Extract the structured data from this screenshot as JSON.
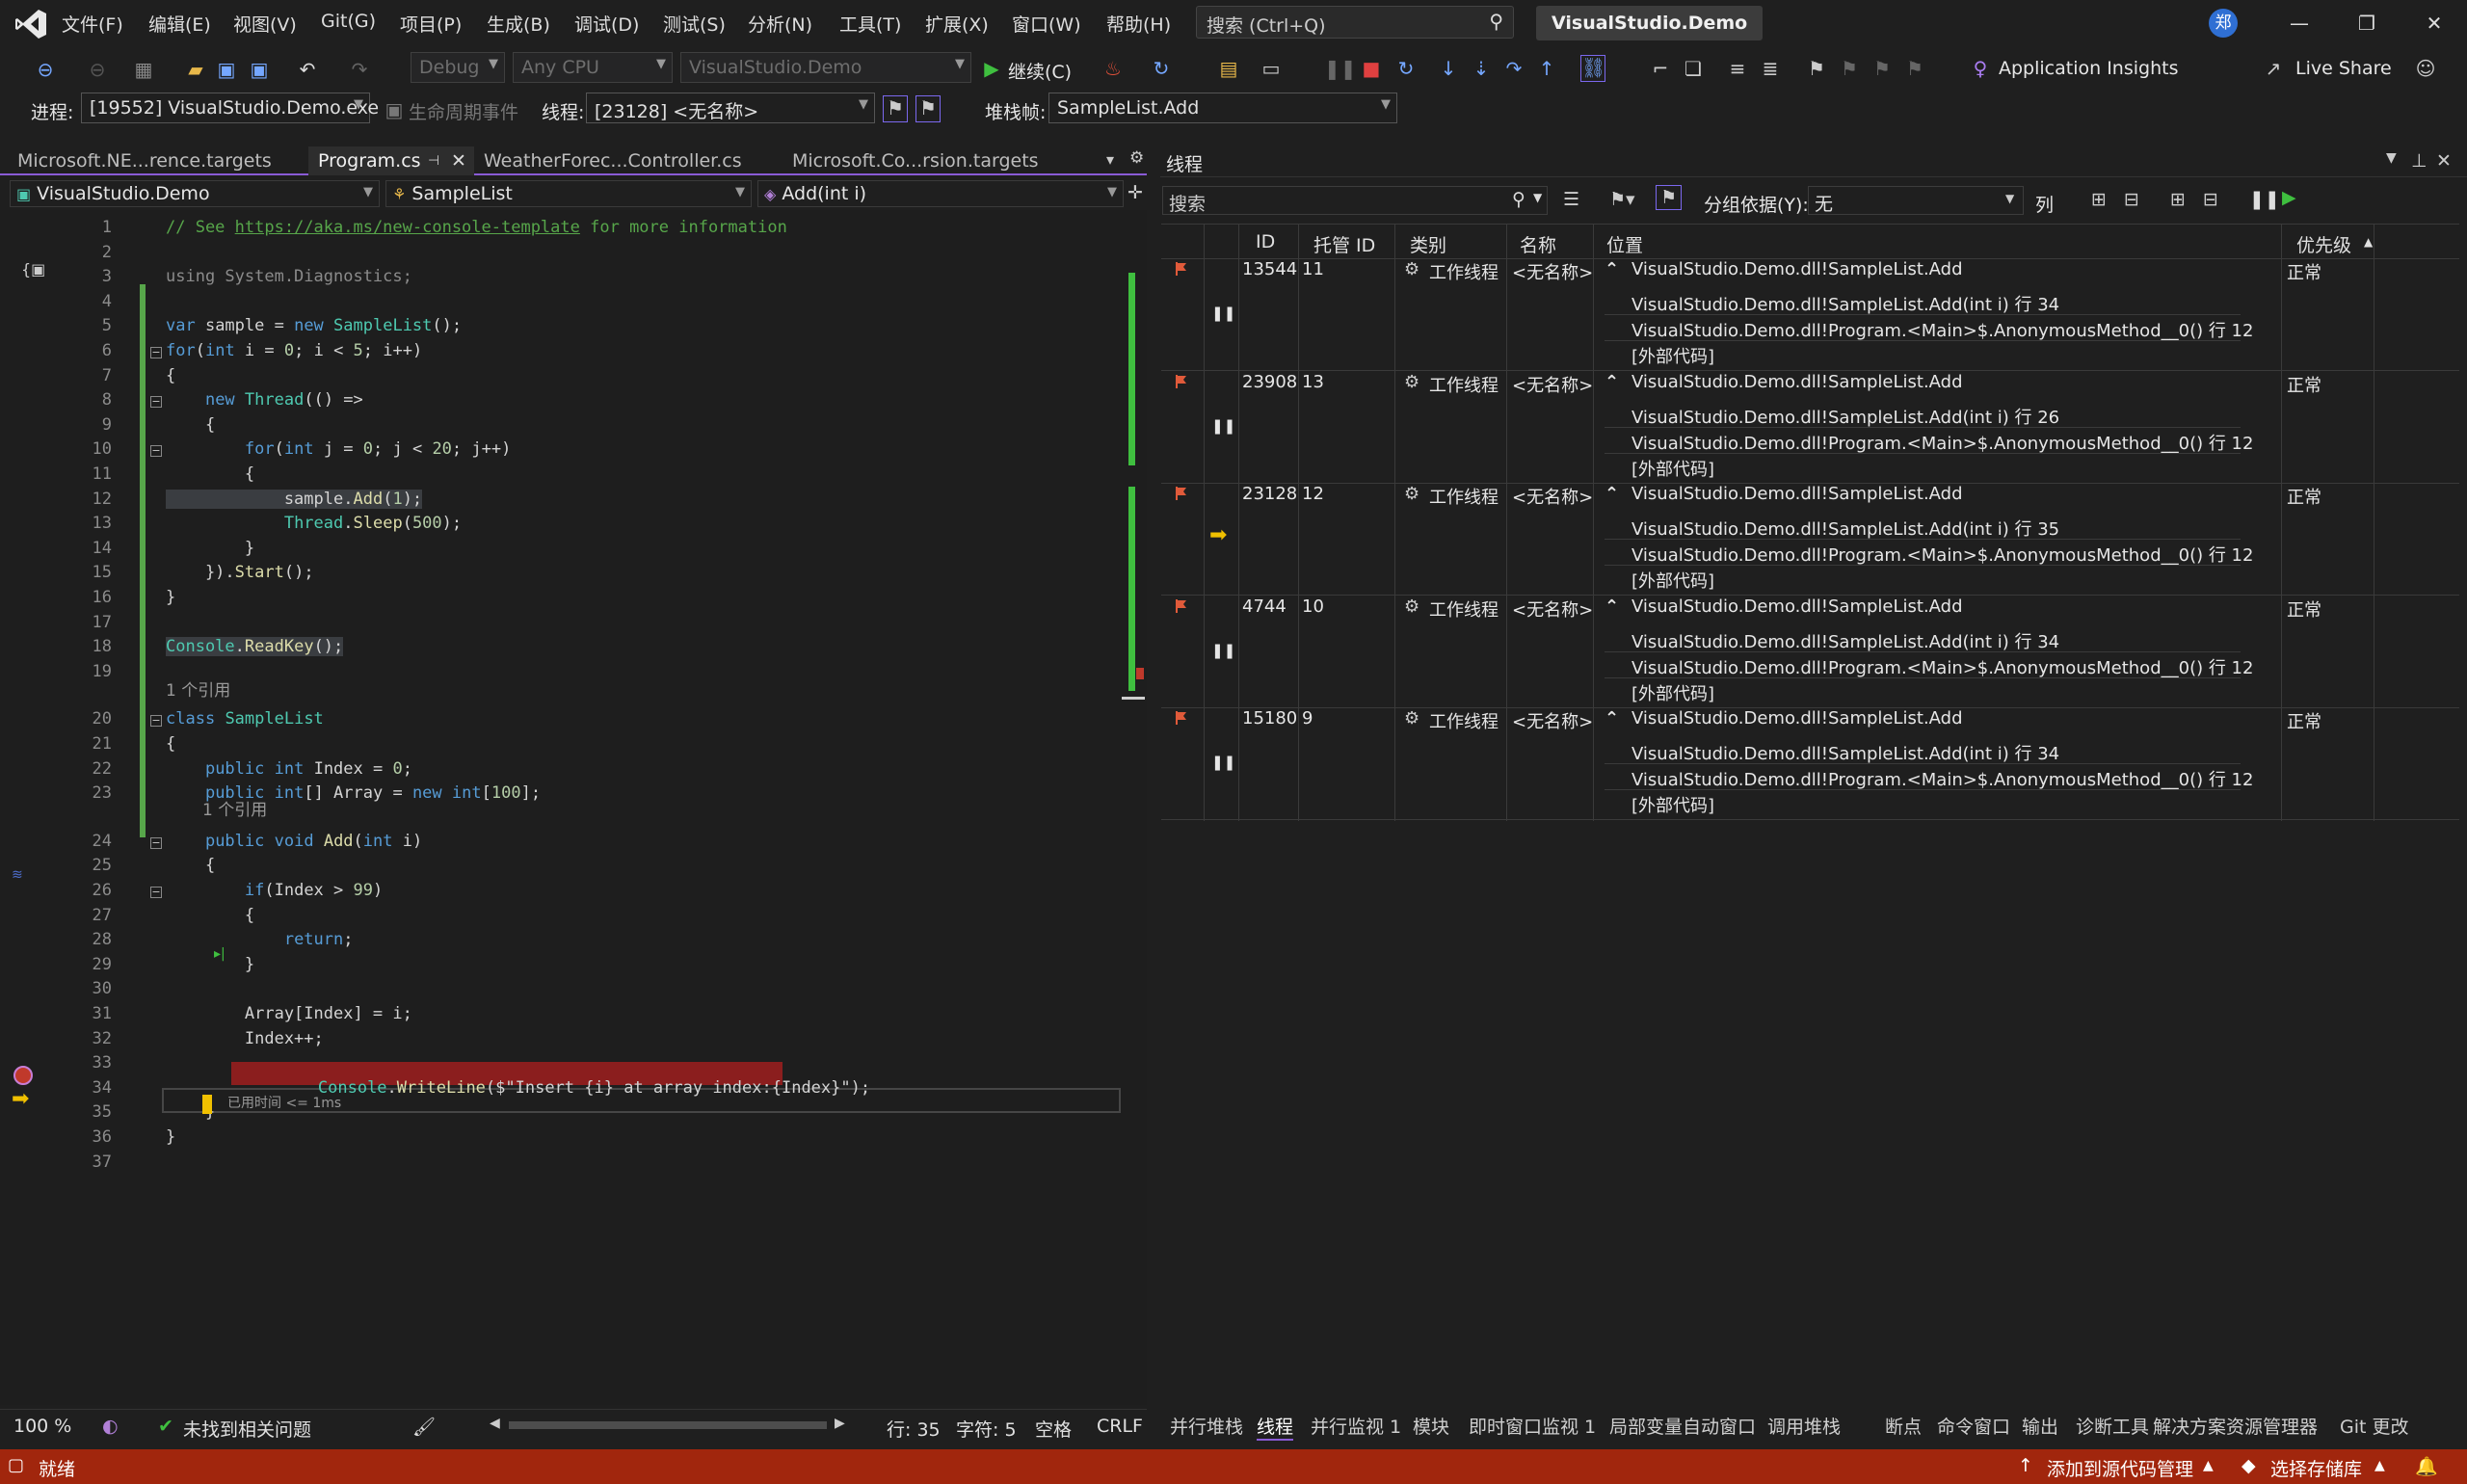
{
  "menu": {
    "items": [
      "文件(F)",
      "编辑(E)",
      "视图(V)",
      "Git(G)",
      "项目(P)",
      "生成(B)",
      "调试(D)",
      "测试(S)",
      "分析(N)",
      "工具(T)",
      "扩展(X)",
      "窗口(W)",
      "帮助(H)"
    ],
    "search_placeholder": "搜索 (Ctrl+Q)",
    "solution": "VisualStudio.Demo",
    "avatar": "郑"
  },
  "toolbar": {
    "config": "Debug",
    "platform": "Any CPU",
    "startup": "VisualStudio.Demo",
    "continue": "继续(C)",
    "app_insights": "Application Insights",
    "live_share": "Live Share"
  },
  "debug_location": {
    "process_label": "进程:",
    "process": "[19552] VisualStudio.Demo.exe",
    "lifecycle": "生命周期事件",
    "thread_label": "线程:",
    "thread": "[23128] <无名称>",
    "stackframe_label": "堆栈帧:",
    "stackframe": "SampleList.Add"
  },
  "doc_tabs": [
    "Microsoft.NE...rence.targets",
    "Program.cs",
    "WeatherForec...Controller.cs",
    "Microsoft.Co...rsion.targets"
  ],
  "nav": {
    "project": "VisualStudio.Demo",
    "class": "SampleList",
    "member": "Add(int i)"
  },
  "code": {
    "lines": [
      {
        "n": "1",
        "segs": [
          {
            "c": "cm",
            "t": "// See "
          },
          {
            "c": "lnk",
            "t": "https://aka.ms/new-console-template"
          },
          {
            "c": "cm",
            "t": " for more information"
          }
        ]
      },
      {
        "n": "2",
        "segs": []
      },
      {
        "n": "3",
        "segs": [
          {
            "c": "dim",
            "t": "using System.Diagnostics;"
          }
        ]
      },
      {
        "n": "4",
        "segs": []
      },
      {
        "n": "5",
        "segs": [
          {
            "c": "kw",
            "t": "var"
          },
          {
            "c": "",
            "t": " sample = "
          },
          {
            "c": "kw",
            "t": "new"
          },
          {
            "c": "",
            "t": " "
          },
          {
            "c": "ty",
            "t": "SampleList"
          },
          {
            "c": "",
            "t": "();"
          }
        ]
      },
      {
        "n": "6",
        "segs": [
          {
            "c": "kw",
            "t": "for"
          },
          {
            "c": "",
            "t": "("
          },
          {
            "c": "kw",
            "t": "int"
          },
          {
            "c": "",
            "t": " i = "
          },
          {
            "c": "nm",
            "t": "0"
          },
          {
            "c": "",
            "t": "; i < "
          },
          {
            "c": "nm",
            "t": "5"
          },
          {
            "c": "",
            "t": "; i++)"
          }
        ]
      },
      {
        "n": "7",
        "segs": [
          {
            "c": "",
            "t": "{"
          }
        ]
      },
      {
        "n": "8",
        "segs": [
          {
            "c": "",
            "t": "    "
          },
          {
            "c": "kw",
            "t": "new"
          },
          {
            "c": "",
            "t": " "
          },
          {
            "c": "ty",
            "t": "Thread"
          },
          {
            "c": "",
            "t": "(() =>"
          }
        ]
      },
      {
        "n": "9",
        "segs": [
          {
            "c": "",
            "t": "    {"
          }
        ]
      },
      {
        "n": "10",
        "segs": [
          {
            "c": "",
            "t": "        "
          },
          {
            "c": "kw",
            "t": "for"
          },
          {
            "c": "",
            "t": "("
          },
          {
            "c": "kw",
            "t": "int"
          },
          {
            "c": "",
            "t": " j = "
          },
          {
            "c": "nm",
            "t": "0"
          },
          {
            "c": "",
            "t": "; j < "
          },
          {
            "c": "nm",
            "t": "20"
          },
          {
            "c": "",
            "t": "; j++)"
          }
        ]
      },
      {
        "n": "11",
        "segs": [
          {
            "c": "",
            "t": "        {"
          }
        ]
      },
      {
        "n": "12",
        "segs": [
          {
            "c": "",
            "t": "            sample."
          },
          {
            "c": "mt",
            "t": "Add"
          },
          {
            "c": "",
            "t": "("
          },
          {
            "c": "nm",
            "t": "1"
          },
          {
            "c": "",
            "t": ");"
          }
        ]
      },
      {
        "n": "13",
        "segs": [
          {
            "c": "",
            "t": "            "
          },
          {
            "c": "ty",
            "t": "Thread"
          },
          {
            "c": "",
            "t": "."
          },
          {
            "c": "mt",
            "t": "Sleep"
          },
          {
            "c": "",
            "t": "("
          },
          {
            "c": "nm",
            "t": "500"
          },
          {
            "c": "",
            "t": ");"
          }
        ]
      },
      {
        "n": "14",
        "segs": [
          {
            "c": "",
            "t": "        }"
          }
        ]
      },
      {
        "n": "15",
        "segs": [
          {
            "c": "",
            "t": "    })."
          },
          {
            "c": "mt",
            "t": "Start"
          },
          {
            "c": "",
            "t": "();"
          }
        ]
      },
      {
        "n": "16",
        "segs": [
          {
            "c": "",
            "t": "}"
          }
        ]
      },
      {
        "n": "17",
        "segs": []
      },
      {
        "n": "18",
        "segs": [
          {
            "c": "ty",
            "t": "Console"
          },
          {
            "c": "",
            "t": "."
          },
          {
            "c": "mt",
            "t": "ReadKey"
          },
          {
            "c": "",
            "t": "();"
          }
        ]
      },
      {
        "n": "19",
        "segs": []
      },
      {
        "n": "20",
        "segs": [
          {
            "c": "kw",
            "t": "class"
          },
          {
            "c": "",
            "t": " "
          },
          {
            "c": "ty",
            "t": "SampleList"
          }
        ]
      },
      {
        "n": "21",
        "segs": [
          {
            "c": "",
            "t": "{"
          }
        ]
      },
      {
        "n": "22",
        "segs": [
          {
            "c": "",
            "t": "    "
          },
          {
            "c": "kw",
            "t": "public"
          },
          {
            "c": "",
            "t": " "
          },
          {
            "c": "kw",
            "t": "int"
          },
          {
            "c": "",
            "t": " Index = "
          },
          {
            "c": "nm",
            "t": "0"
          },
          {
            "c": "",
            "t": ";"
          }
        ]
      },
      {
        "n": "23",
        "segs": [
          {
            "c": "",
            "t": "    "
          },
          {
            "c": "kw",
            "t": "public"
          },
          {
            "c": "",
            "t": " "
          },
          {
            "c": "kw",
            "t": "int"
          },
          {
            "c": "",
            "t": "[] Array = "
          },
          {
            "c": "kw",
            "t": "new"
          },
          {
            "c": "",
            "t": " "
          },
          {
            "c": "kw",
            "t": "int"
          },
          {
            "c": "",
            "t": "["
          },
          {
            "c": "nm",
            "t": "100"
          },
          {
            "c": "",
            "t": "];"
          }
        ]
      },
      {
        "n": "24",
        "segs": [
          {
            "c": "",
            "t": "    "
          },
          {
            "c": "kw",
            "t": "public"
          },
          {
            "c": "",
            "t": " "
          },
          {
            "c": "kw",
            "t": "void"
          },
          {
            "c": "",
            "t": " "
          },
          {
            "c": "mt",
            "t": "Add"
          },
          {
            "c": "",
            "t": "("
          },
          {
            "c": "kw",
            "t": "int"
          },
          {
            "c": "",
            "t": " i)"
          }
        ]
      },
      {
        "n": "25",
        "segs": [
          {
            "c": "",
            "t": "    {"
          }
        ]
      },
      {
        "n": "26",
        "segs": [
          {
            "c": "",
            "t": "        "
          },
          {
            "c": "kw",
            "t": "if"
          },
          {
            "c": "",
            "t": "(Index > "
          },
          {
            "c": "nm",
            "t": "99"
          },
          {
            "c": "",
            "t": ")"
          }
        ]
      },
      {
        "n": "27",
        "segs": [
          {
            "c": "",
            "t": "        {"
          }
        ]
      },
      {
        "n": "28",
        "segs": [
          {
            "c": "",
            "t": "            "
          },
          {
            "c": "kw",
            "t": "return"
          },
          {
            "c": "",
            "t": ";"
          }
        ]
      },
      {
        "n": "29",
        "segs": [
          {
            "c": "",
            "t": "        }"
          }
        ]
      },
      {
        "n": "30",
        "segs": []
      },
      {
        "n": "31",
        "segs": [
          {
            "c": "",
            "t": "        Array[Index] = i;"
          }
        ]
      },
      {
        "n": "32",
        "segs": [
          {
            "c": "",
            "t": "        Index++;"
          }
        ]
      },
      {
        "n": "33",
        "segs": []
      },
      {
        "n": "34",
        "segs": [
          {
            "c": "",
            "t": "        "
          },
          {
            "c": "ty",
            "t": "Console"
          },
          {
            "c": "",
            "t": "."
          },
          {
            "c": "mt",
            "t": "WriteLine"
          },
          {
            "c": "",
            "t": "($\"Insert {i} at array index:{Index}\");"
          }
        ]
      },
      {
        "n": "35",
        "segs": [
          {
            "c": "",
            "t": "    }"
          }
        ]
      },
      {
        "n": "36",
        "segs": [
          {
            "c": "",
            "t": "}"
          }
        ]
      },
      {
        "n": "37",
        "segs": []
      }
    ],
    "ref_label": "1 个引用",
    "elapsed": "已用时间 <= 1ms"
  },
  "editor_status": {
    "zoom": "100 %",
    "issues": "未找到相关问题",
    "line": "行: 35",
    "char": "字符: 5",
    "spaces": "空格",
    "eol": "CRLF"
  },
  "threads": {
    "title": "线程",
    "search_placeholder": "搜索",
    "group_label": "分组依据(Y):",
    "group_value": "无",
    "columns_label": "列",
    "headers": [
      "ID",
      "托管 ID",
      "类别",
      "名称",
      "位置",
      "优先级"
    ],
    "rows": [
      {
        "id": "13544",
        "managed": "11",
        "category": "工作线程",
        "name": "<无名称>",
        "location": "VisualStudio.Demo.dll!SampleList.Add",
        "frames": [
          "VisualStudio.Demo.dll!SampleList.Add(int i) 行 34",
          "VisualStudio.Demo.dll!Program.<Main>$.AnonymousMethod__0() 行 12",
          "[外部代码]"
        ],
        "priority": "正常",
        "current": false
      },
      {
        "id": "23908",
        "managed": "13",
        "category": "工作线程",
        "name": "<无名称>",
        "location": "VisualStudio.Demo.dll!SampleList.Add",
        "frames": [
          "VisualStudio.Demo.dll!SampleList.Add(int i) 行 26",
          "VisualStudio.Demo.dll!Program.<Main>$.AnonymousMethod__0() 行 12",
          "[外部代码]"
        ],
        "priority": "正常",
        "current": false
      },
      {
        "id": "23128",
        "managed": "12",
        "category": "工作线程",
        "name": "<无名称>",
        "location": "VisualStudio.Demo.dll!SampleList.Add",
        "frames": [
          "VisualStudio.Demo.dll!SampleList.Add(int i) 行 35",
          "VisualStudio.Demo.dll!Program.<Main>$.AnonymousMethod__0() 行 12",
          "[外部代码]"
        ],
        "priority": "正常",
        "current": true
      },
      {
        "id": "4744",
        "managed": "10",
        "category": "工作线程",
        "name": "<无名称>",
        "location": "VisualStudio.Demo.dll!SampleList.Add",
        "frames": [
          "VisualStudio.Demo.dll!SampleList.Add(int i) 行 34",
          "VisualStudio.Demo.dll!Program.<Main>$.AnonymousMethod__0() 行 12",
          "[外部代码]"
        ],
        "priority": "正常",
        "current": false
      },
      {
        "id": "15180",
        "managed": "9",
        "category": "工作线程",
        "name": "<无名称>",
        "location": "VisualStudio.Demo.dll!SampleList.Add",
        "frames": [
          "VisualStudio.Demo.dll!SampleList.Add(int i) 行 34",
          "VisualStudio.Demo.dll!Program.<Main>$.AnonymousMethod__0() 行 12",
          "[外部代码]"
        ],
        "priority": "正常",
        "current": false
      }
    ]
  },
  "bottom_tabs": [
    "并行堆栈",
    "线程",
    "并行监视 1",
    "模块",
    "即时窗口",
    "监视 1",
    "局部变量",
    "自动窗口",
    "调用堆栈",
    "断点",
    "命令窗口",
    "输出",
    "诊断工具",
    "解决方案资源管理器",
    "Git 更改"
  ],
  "status": {
    "ready": "就绪",
    "add_source": "添加到源代码管理",
    "select_repo": "选择存储库"
  },
  "colors": {
    "accent": "#8a5bd6",
    "status_bar": "#a1260d",
    "breakpoint": "#8b1e1e",
    "flag": "#e05a3a",
    "current_arrow": "#f0c000"
  }
}
